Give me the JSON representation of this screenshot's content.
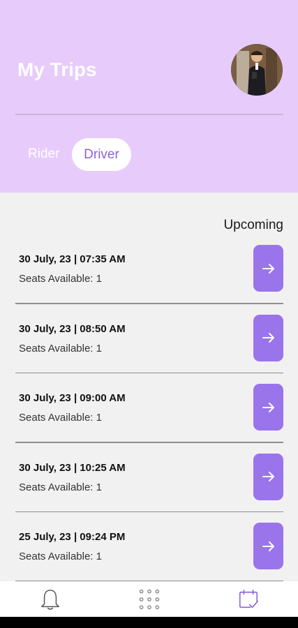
{
  "header": {
    "title": "My Trips",
    "avatar_icon": "user-avatar-photo",
    "background_color": "#e7cbfb"
  },
  "role_toggle": {
    "options": [
      "Rider",
      "Driver"
    ],
    "selected": "Driver"
  },
  "section": {
    "label": "Upcoming"
  },
  "trips": [
    {
      "datetime": "30 July, 23 | 07:35 AM",
      "seats": "Seats Available: 1"
    },
    {
      "datetime": "30 July, 23 | 08:50 AM",
      "seats": "Seats Available: 1"
    },
    {
      "datetime": "30 July, 23 | 09:00 AM",
      "seats": "Seats Available: 1"
    },
    {
      "datetime": "30 July, 23 | 10:25 AM",
      "seats": "Seats Available: 1"
    },
    {
      "datetime": "25 July, 23 | 09:24 PM",
      "seats": "Seats Available: 1"
    }
  ],
  "trip_action_icon": "arrow-right-icon",
  "accent_color": "#9a74ea",
  "bottom_nav": {
    "items": [
      {
        "icon": "bell-icon",
        "active": false
      },
      {
        "icon": "grid-dots-icon",
        "active": false
      },
      {
        "icon": "calendar-check-icon",
        "active": true
      }
    ]
  }
}
